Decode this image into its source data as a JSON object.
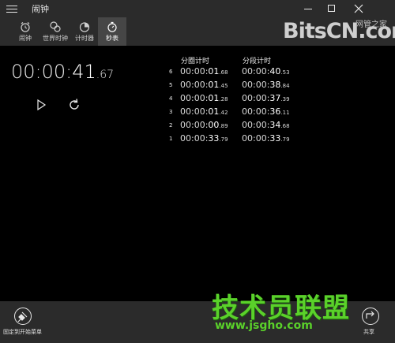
{
  "window": {
    "title": "闹钟"
  },
  "tabs": [
    {
      "label": "闹钟",
      "icon": "alarm-icon",
      "selected": false
    },
    {
      "label": "世界时钟",
      "icon": "world-clock-icon",
      "selected": false
    },
    {
      "label": "计时器",
      "icon": "timer-icon",
      "selected": false
    },
    {
      "label": "秒表",
      "icon": "stopwatch-icon",
      "selected": true
    }
  ],
  "stopwatch": {
    "time_main": "00:00:",
    "time_seconds": "41",
    "time_centis": ".67"
  },
  "laps": {
    "header_total": "分圈计时",
    "header_split": "分段计时",
    "rows": [
      {
        "index": "6",
        "total": "00:00:",
        "total_sec": "01",
        "total_cs": ".68",
        "split": "00:00:",
        "split_sec": "40",
        "split_cs": ".53"
      },
      {
        "index": "5",
        "total": "00:00:",
        "total_sec": "01",
        "total_cs": ".45",
        "split": "00:00:",
        "split_sec": "38",
        "split_cs": ".84"
      },
      {
        "index": "4",
        "total": "00:00:",
        "total_sec": "01",
        "total_cs": ".28",
        "split": "00:00:",
        "split_sec": "37",
        "split_cs": ".39"
      },
      {
        "index": "3",
        "total": "00:00:",
        "total_sec": "01",
        "total_cs": ".42",
        "split": "00:00:",
        "split_sec": "36",
        "split_cs": ".11"
      },
      {
        "index": "2",
        "total": "00:00:",
        "total_sec": "00",
        "total_cs": ".89",
        "split": "00:00:",
        "split_sec": "34",
        "split_cs": ".68"
      },
      {
        "index": "1",
        "total": "00:00:",
        "total_sec": "33",
        "total_cs": ".79",
        "split": "00:00:",
        "split_sec": "33",
        "split_cs": ".79"
      }
    ]
  },
  "bottom": {
    "pin_label": "固定到开始菜单",
    "share_label": "共享"
  },
  "watermarks": {
    "top": "BitsCN.com",
    "top_sub": "网管之家",
    "bottom_main": "技术员联盟",
    "bottom_url": "www.jsgho.com"
  },
  "colors": {
    "chrome": "#2b2b2b",
    "selected_tab": "#464646",
    "background": "#000000",
    "watermark_green": "#5ad12a"
  }
}
